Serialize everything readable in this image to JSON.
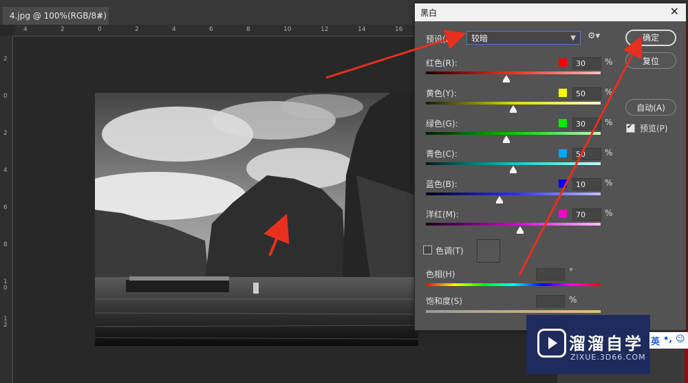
{
  "document_tab": {
    "title": "4.jpg @ 100%(RGB/8#)",
    "close": "×"
  },
  "ruler_h_labels": [
    "4",
    "2",
    "0",
    "2",
    "4",
    "6",
    "8",
    "10",
    "12",
    "14",
    "16"
  ],
  "ruler_v_labels": [
    "2",
    "0",
    "2",
    "4",
    "6",
    "8",
    "1\n0",
    "1\n2"
  ],
  "dialog": {
    "title": "黑白",
    "close": "✕",
    "preset_label": "预设(E):",
    "preset_value": "较暗",
    "buttons": {
      "ok": "确定",
      "reset": "复位",
      "auto": "自动(A)"
    },
    "preview_label": "预览(P)",
    "sliders": [
      {
        "label": "红色(R):",
        "value": "30",
        "color": "#ff0000",
        "level": 0.46
      },
      {
        "label": "黄色(Y):",
        "value": "50",
        "color": "#ffff00",
        "level": 0.5
      },
      {
        "label": "绿色(G):",
        "value": "30",
        "color": "#00ee00",
        "level": 0.46
      },
      {
        "label": "青色(C):",
        "value": "50",
        "color": "#00a8ff",
        "level": 0.5
      },
      {
        "label": "蓝色(B):",
        "value": "10",
        "color": "#0000ff",
        "level": 0.42
      },
      {
        "label": "洋红(M):",
        "value": "70",
        "color": "#ff00c8",
        "level": 0.54
      }
    ],
    "percent": "%",
    "tint_label": "色调(T)",
    "hue_label": "色相(H)",
    "hue_unit": "°",
    "saturation_label": "饱和度(S)",
    "saturation_unit": "%"
  },
  "watermark": {
    "brand": "溜溜自学",
    "url": "ZIXUE.3D66.COM"
  },
  "ime": {
    "text1": "英",
    "text2": "•,",
    "emoji": "☺"
  }
}
